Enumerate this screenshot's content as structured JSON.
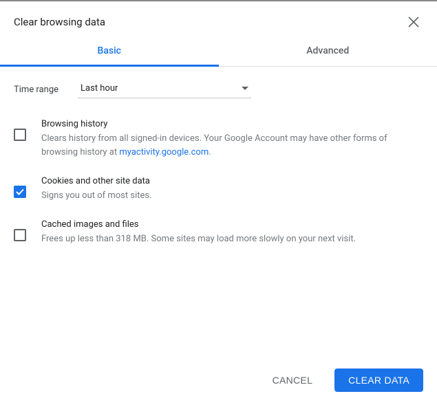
{
  "title": "Clear browsing data",
  "tabs": {
    "basic": "Basic",
    "advanced": "Advanced"
  },
  "time_range": {
    "label": "Time range",
    "value": "Last hour"
  },
  "options": {
    "browsing_history": {
      "title": "Browsing history",
      "desc_before": "Clears history from all signed-in devices. Your Google Account may have other forms of browsing history at ",
      "link_text": "myactivity.google.com",
      "desc_after": "."
    },
    "cookies": {
      "title": "Cookies and other site data",
      "desc": "Signs you out of most sites."
    },
    "cache": {
      "title": "Cached images and files",
      "desc": "Frees up less than 318 MB. Some sites may load more slowly on your next visit."
    }
  },
  "buttons": {
    "cancel": "CANCEL",
    "clear": "CLEAR DATA"
  }
}
